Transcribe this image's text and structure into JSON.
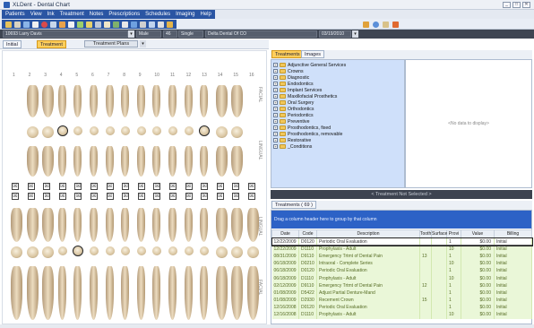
{
  "window": {
    "title": "XLDent - Dental Chart",
    "controls": [
      "_",
      "□",
      "✕"
    ]
  },
  "menu": [
    "Patients",
    "View",
    "Ink",
    "Treatment",
    "Notes",
    "Prescriptions",
    "Schedules",
    "Imaging",
    "Help"
  ],
  "patient_bar": {
    "name": "10693 Larry Davis",
    "status": "Male",
    "age": "46",
    "marital": "Single",
    "insurance": "Delta Dental Of CO",
    "date": "03/19/2010"
  },
  "left_tabs": {
    "initial": "Initial",
    "treatment": "Treatment",
    "plans": "Treatment Plans"
  },
  "chart": {
    "upper_numbers": [
      "1",
      "2",
      "3",
      "4",
      "5",
      "6",
      "7",
      "8",
      "9",
      "10",
      "11",
      "12",
      "13",
      "14",
      "15",
      "16"
    ],
    "lower_numbers": [
      "32",
      "31",
      "30",
      "29",
      "28",
      "27",
      "26",
      "25",
      "24",
      "23",
      "22",
      "21",
      "20",
      "19",
      "18",
      "17"
    ],
    "side_labels": {
      "top": "FACIAL",
      "mid1": "LINGUAL",
      "mid2": "LINGUAL",
      "bottom": "FACIAL"
    },
    "x_marker": "☒"
  },
  "right_tabs": {
    "treatments": "Treatments",
    "images": "Images"
  },
  "tree_items": [
    "Adjunctive General Services",
    "Crowns",
    "Diagnostic",
    "Endodontics",
    "Implant Services",
    "Maxillofacial Prosthetics",
    "Oral Surgery",
    "Orthodontics",
    "Periodontics",
    "Preventive",
    "Prosthodontics, fixed",
    "Prosthodontics, removable",
    "Restorative",
    "_Conditions"
  ],
  "no_data_text": "<No data to display>",
  "banner": "< Treatment Not Selected >",
  "treatments_panel": {
    "tab_label": "Treatments ( 69 )",
    "group_hint": "Drag a column header here to group by that column",
    "columns": [
      "Date",
      "Code",
      "Description",
      "Tooth",
      "Surface",
      "Provi",
      "Value",
      "Billing"
    ],
    "rows": [
      [
        "12/22/2009",
        "D0120",
        "Periodic Oral Evaluation",
        "",
        "",
        "1",
        "$0.00",
        "Initial"
      ],
      [
        "12/22/2009",
        "D1110",
        "Prophylaxis - Adult",
        "",
        "",
        "10",
        "$0.00",
        "Initial"
      ],
      [
        "08/31/2009",
        "D9110",
        "Emergency Trtmt of Dental Pain",
        "13",
        "",
        "1",
        "$0.00",
        "Initial"
      ],
      [
        "06/18/2009",
        "D0210",
        "Intraoral - Complete Series",
        "",
        "",
        "10",
        "$0.00",
        "Initial"
      ],
      [
        "06/18/2009",
        "D0120",
        "Periodic Oral Evaluation",
        "",
        "",
        "1",
        "$0.00",
        "Initial"
      ],
      [
        "06/18/2009",
        "D1110",
        "Prophylaxis - Adult",
        "",
        "",
        "10",
        "$0.00",
        "Initial"
      ],
      [
        "02/12/2009",
        "D9110",
        "Emergency Trtmt of Dental Pain",
        "12",
        "",
        "1",
        "$0.00",
        "Initial"
      ],
      [
        "01/08/2009",
        "D5422",
        "Adjust Partial Denture-Mand",
        "",
        "",
        "1",
        "$0.00",
        "Initial"
      ],
      [
        "01/08/2009",
        "D2930",
        "Recement Crown",
        "15",
        "",
        "1",
        "$0.00",
        "Initial"
      ],
      [
        "12/16/2008",
        "D0120",
        "Periodic Oral Evaluation",
        "",
        "",
        "1",
        "$0.00",
        "Initial"
      ],
      [
        "12/16/2008",
        "D1110",
        "Prophylaxis - Adult",
        "",
        "",
        "10",
        "$0.00",
        "Initial"
      ]
    ]
  },
  "colors": {
    "menu_blue": "#2a55a3",
    "active_tab": "#ffcf5c",
    "group_header": "#2d62c6",
    "row_green": "#eaf7d8"
  }
}
